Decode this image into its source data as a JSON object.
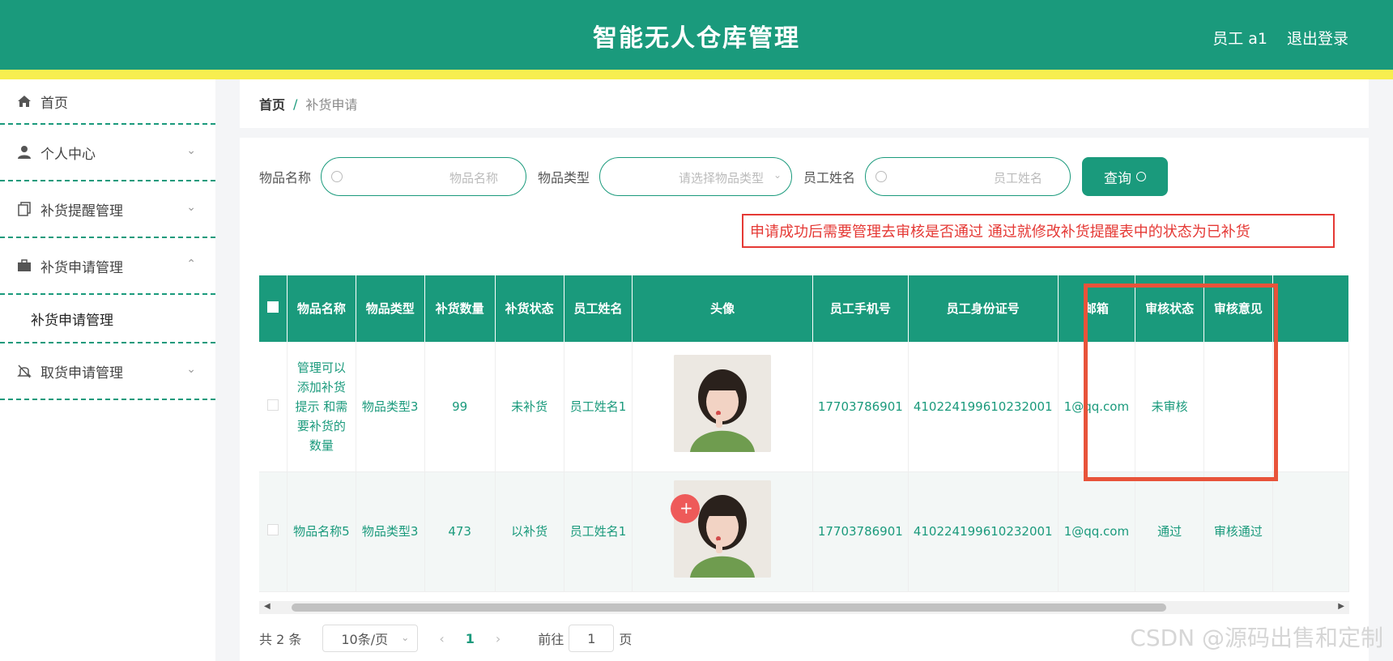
{
  "header": {
    "title": "智能无人仓库管理",
    "user": "员工 a1",
    "logout": "退出登录"
  },
  "sidebar": {
    "items": [
      {
        "label": "首页",
        "icon": "home-icon"
      },
      {
        "label": "个人中心",
        "icon": "user-icon"
      },
      {
        "label": "补货提醒管理",
        "icon": "copy-icon"
      },
      {
        "label": "补货申请管理",
        "icon": "briefcase-icon"
      },
      {
        "label": "取货申请管理",
        "icon": "bell-off-icon"
      }
    ],
    "sub_item": "补货申请管理"
  },
  "breadcrumb": {
    "home": "首页",
    "sep": "/",
    "current": "补货申请"
  },
  "search": {
    "item_name_label": "物品名称",
    "item_name_placeholder": "物品名称",
    "item_type_label": "物品类型",
    "item_type_placeholder": "请选择物品类型",
    "staff_name_label": "员工姓名",
    "staff_name_placeholder": "员工姓名",
    "query": "查询"
  },
  "notice": "申请成功后需要管理去审核是否通过 通过就修改补货提醒表中的状态为已补货",
  "table": {
    "headers": [
      "物品名称",
      "物品类型",
      "补货数量",
      "补货状态",
      "员工姓名",
      "头像",
      "员工手机号",
      "员工身份证号",
      "邮箱",
      "审核状态",
      "审核意见"
    ],
    "rows": [
      {
        "item_name": "管理可以添加补货提示 和需要补货的数量",
        "item_type": "物品类型3",
        "qty": "99",
        "status": "未补货",
        "staff": "员工姓名1",
        "phone": "17703786901",
        "id_card": "410224199610232001",
        "email": "1@qq.com",
        "review": "未审核",
        "opinion": ""
      },
      {
        "item_name": "物品名称5",
        "item_type": "物品类型3",
        "qty": "473",
        "status": "以补货",
        "staff": "员工姓名1",
        "phone": "17703786901",
        "id_card": "410224199610232001",
        "email": "1@qq.com",
        "review": "通过",
        "opinion": "审核通过"
      }
    ]
  },
  "pager": {
    "total": "共 2 条",
    "page_size": "10条/页",
    "prev": "‹",
    "current": "1",
    "next": "›",
    "goto": "前往",
    "goto_value": "1",
    "page_suffix": "页"
  },
  "watermark": "CSDN @源码出售和定制",
  "colors": {
    "primary": "#1a9a7c",
    "stripe": "#f7ee4f",
    "alert": "#e53935"
  }
}
